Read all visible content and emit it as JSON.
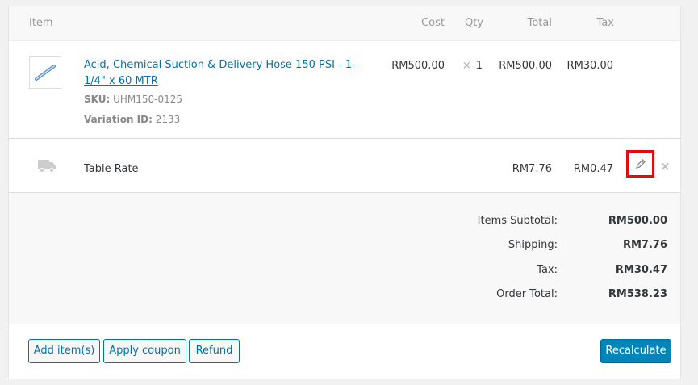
{
  "header": {
    "item": "Item",
    "cost": "Cost",
    "qty": "Qty",
    "total": "Total",
    "tax": "Tax"
  },
  "line_item": {
    "name": "Acid, Chemical Suction & Delivery Hose 150 PSI - 1-1/4\" x 60 MTR",
    "sku_label": "SKU:",
    "sku": "UHM150-0125",
    "variation_label": "Variation ID:",
    "variation_id": "2133",
    "cost": "RM500.00",
    "qty_x": "×",
    "qty": "1",
    "total": "RM500.00",
    "tax": "RM30.00",
    "thumbnail_icon": "hose-icon"
  },
  "shipping_line": {
    "name": "Table Rate",
    "total": "RM7.76",
    "tax": "RM0.47",
    "icon": "truck-icon",
    "edit_icon": "pencil-icon",
    "delete_symbol": "×"
  },
  "totals": {
    "subtotal_label": "Items Subtotal:",
    "subtotal": "RM500.00",
    "shipping_label": "Shipping:",
    "shipping": "RM7.76",
    "tax_label": "Tax:",
    "tax": "RM30.47",
    "order_total_label": "Order Total:",
    "order_total": "RM538.23"
  },
  "actions": {
    "add_items": "Add item(s)",
    "apply_coupon": "Apply coupon",
    "refund": "Refund",
    "recalculate": "Recalculate"
  },
  "colors": {
    "link": "#0073aa",
    "primary_button": "#0085ba",
    "highlight": "#e30b0b"
  }
}
